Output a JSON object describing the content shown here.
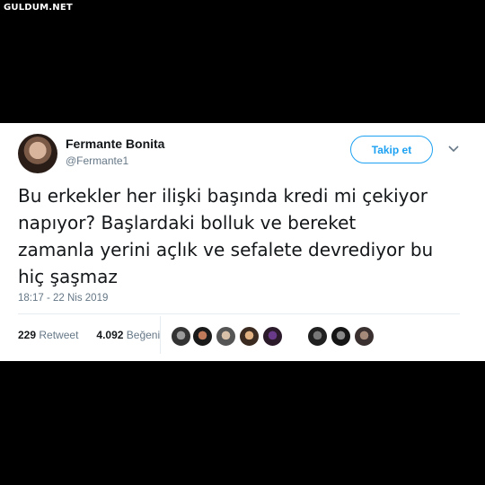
{
  "watermark": "GULDUM.NET",
  "tweet": {
    "author_name": "Fermante Bonita",
    "author_handle": "@Fermante1",
    "follow_label": "Takip et",
    "text_lines": [
      "Bu erkekler her ilişki başında kredi mi çekiyor",
      "napıyor? Başlardaki bolluk ve bereket",
      "zamanla yerini açlık ve sefalete devrediyor bu",
      "hiç şaşmaz"
    ],
    "timestamp": "18:17 - 22 Nis 2019",
    "retweet_count": "229",
    "retweet_label": "Retweet",
    "like_count": "4.092",
    "like_label": "Beğeni"
  },
  "colors": {
    "accent": "#1da1f2",
    "text_primary": "#14171a",
    "text_secondary": "#657786"
  },
  "icons": {
    "more": "chevron-down-icon"
  }
}
